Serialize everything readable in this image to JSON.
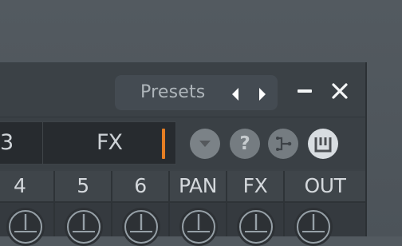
{
  "titlebar": {
    "presets_label": "Presets"
  },
  "toolbar": {
    "display_left_text": "3",
    "display_right_text": "FX"
  },
  "mixer": {
    "channels": [
      {
        "label": "4"
      },
      {
        "label": "5"
      },
      {
        "label": "6"
      },
      {
        "label": "PAN"
      },
      {
        "label": "FX"
      },
      {
        "label": "OUT"
      }
    ]
  }
}
